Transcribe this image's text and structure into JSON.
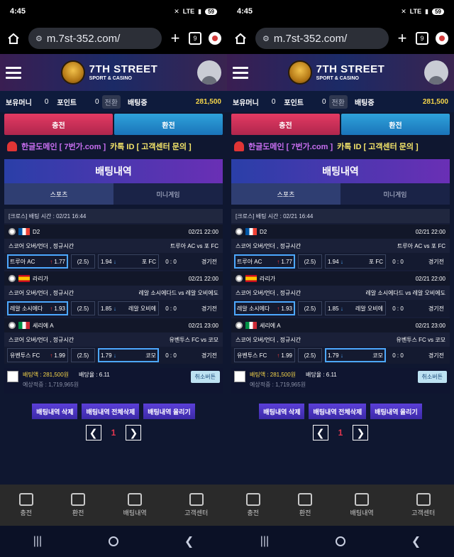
{
  "status_bar": {
    "time": "4:45",
    "network": "LTE",
    "battery": "59"
  },
  "browser": {
    "url": "m.7st-352.com/",
    "tab_count": "9"
  },
  "site": {
    "logo_title": "7TH STREET",
    "logo_subtitle": "SPORT & CASINO"
  },
  "balance": {
    "money_label": "보유머니",
    "money_value": "0",
    "point_label": "포인트",
    "point_value": "0",
    "convert_label": "전환",
    "betting_label": "배팅중",
    "betting_value": "281,500"
  },
  "actions": {
    "deposit": "충전",
    "withdraw": "환전"
  },
  "notice": {
    "text_a": "한글도메인 [ 7번가.com ]",
    "text_b": "카톡 ID [ 고객센터 문의 ]"
  },
  "section_title": "배팅내역",
  "tabs": {
    "sports": "스포츠",
    "minigame": "미니게임"
  },
  "bet": {
    "header": "[크로스] 배팅 시간 : 02/21 16:44",
    "matches": [
      {
        "league": "D2",
        "datetime": "02/21 22:00",
        "market": "스코어 오버/언더 , 정규시간",
        "teams": "트루아 AC vs 포 FC",
        "home_name": "트루아 AC",
        "home_odd": "1.77",
        "draw": "(2.5)",
        "away_odd": "1.94",
        "away_name": "포 FC",
        "score": "0 : 0",
        "status": "경기전"
      },
      {
        "league": "라리가",
        "datetime": "02/21 22:00",
        "market": "스코어 오버/언더 , 정규시간",
        "teams": "레알 소시에다드 vs 레알 오비에도",
        "home_name": "레알 소시에다",
        "home_odd": "1.93",
        "draw": "(2.5)",
        "away_odd": "1.85",
        "away_name": "레알 오비에",
        "score": "0 : 0",
        "status": "경기전"
      },
      {
        "league": "세리에 A",
        "datetime": "02/21 23:00",
        "market": "스코어 오버/언더 , 정규시간",
        "teams": "유벤투스 FC vs 코모",
        "home_name": "유벤투스 FC",
        "home_odd": "1.99",
        "draw": "(2.5)",
        "away_odd": "1.79",
        "away_name": "코모",
        "score": "0 : 0",
        "status": "경기전"
      }
    ],
    "summary": {
      "bet_amount": "배팅액 : 281,500원",
      "bet_odds": "배당율 : 6.11",
      "expected": "예상적중 : 1,719,965원",
      "cancel": "취소버튼"
    }
  },
  "bottom_actions": {
    "delete": "배팅내역 삭제",
    "delete_all": "배팅내역 전체삭제",
    "upload": "배팅내역 올리기"
  },
  "pager": {
    "page": "1",
    "prev": "❮",
    "next": "❯"
  },
  "footer": {
    "deposit": "충전",
    "withdraw": "환전",
    "history": "배팅내역",
    "support": "고객센터"
  },
  "sysnav": {
    "recent": "|||",
    "back": "❮"
  }
}
